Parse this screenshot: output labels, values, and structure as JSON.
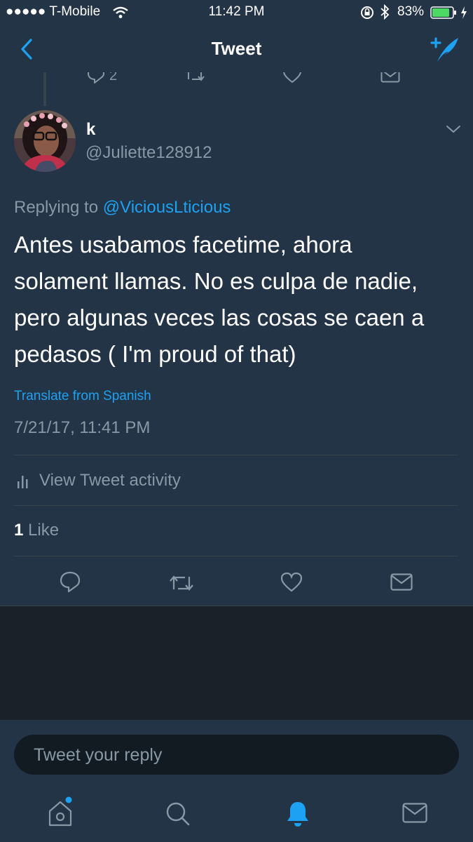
{
  "status_bar": {
    "carrier": "●●●●● T-Mobile",
    "time": "11:42 PM",
    "battery": "83%"
  },
  "nav": {
    "title": "Tweet"
  },
  "prev_tweet": {
    "reply_count": "2"
  },
  "tweet": {
    "display_name": "k",
    "handle": "@Juliette128912",
    "replying_prefix": "Replying to",
    "replying_handle": "@ViciousLticious",
    "text_lines": [
      "Antes usabamos facetime, ahora",
      "solament llamas. No es culpa de nadie,",
      "pero algunas veces las cosas se caen a",
      "pedasos ( I'm proud of that)"
    ],
    "translate": "Translate from Spanish",
    "timestamp": "7/21/17, 11:41 PM",
    "activity": "View Tweet activity",
    "like_count": "1",
    "like_label": "Like"
  },
  "reply": {
    "placeholder": "Tweet your reply"
  },
  "colors": {
    "accent": "#1da1f2",
    "background": "#243447",
    "muted": "#8899a6"
  },
  "icons": {
    "nav": [
      "back-chevron-icon",
      "compose-icon"
    ],
    "actions": [
      "reply-icon",
      "retweet-icon",
      "like-icon",
      "dm-icon"
    ],
    "tabs": [
      "home-icon",
      "search-icon",
      "notifications-icon",
      "messages-icon"
    ]
  }
}
